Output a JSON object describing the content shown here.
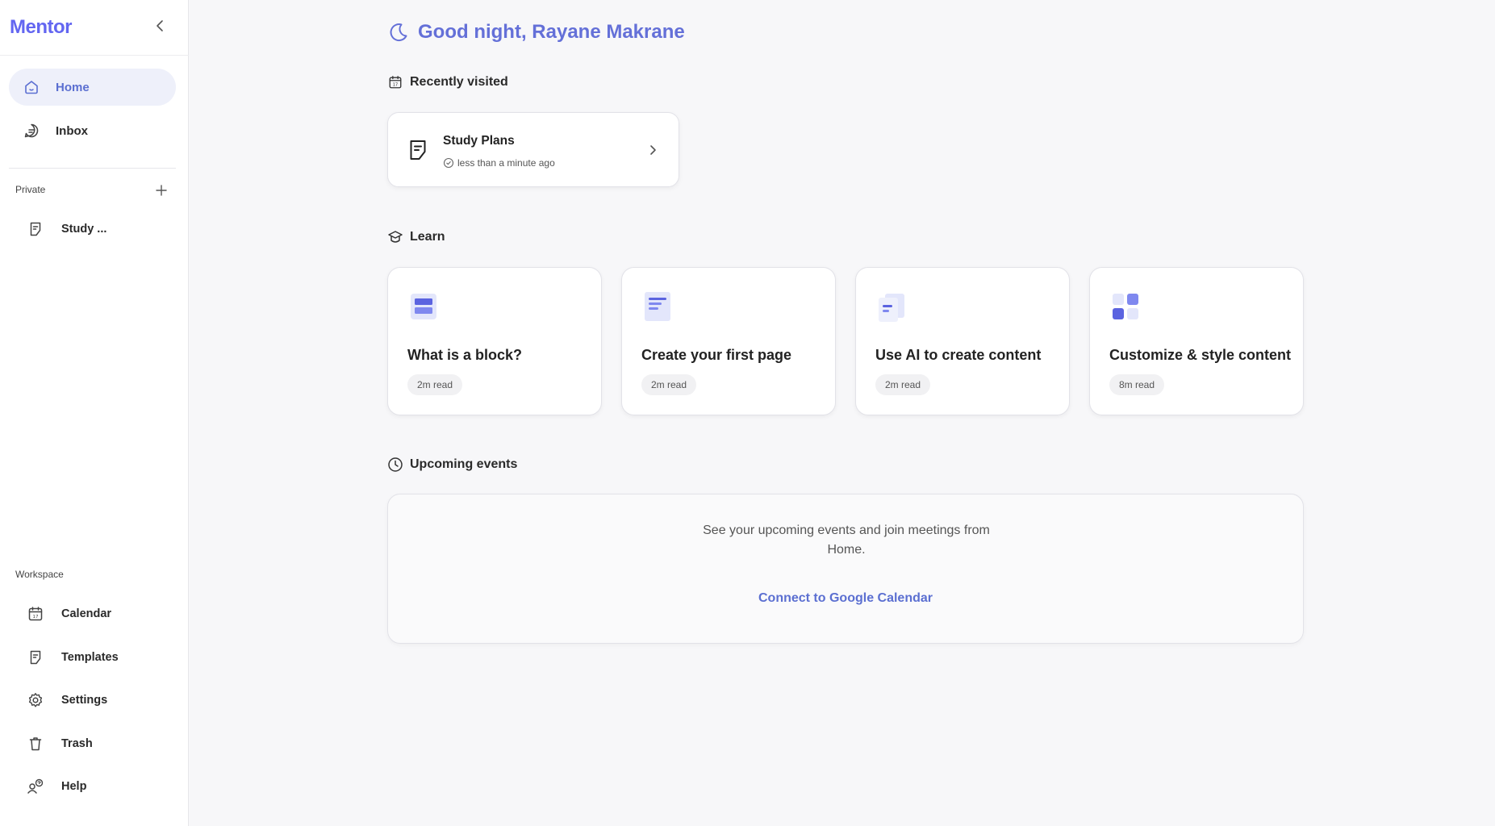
{
  "sidebar": {
    "brand": "Mentor",
    "nav": [
      {
        "label": "Home",
        "icon": "home-icon",
        "active": true
      },
      {
        "label": "Inbox",
        "icon": "inbox-icon",
        "active": false
      }
    ],
    "private_label": "Private",
    "private_items": [
      {
        "label": "Study ...",
        "icon": "document-icon"
      }
    ],
    "workspace_label": "Workspace",
    "workspace_items": [
      {
        "label": "Calendar",
        "icon": "calendar-icon"
      },
      {
        "label": "Templates",
        "icon": "template-icon"
      },
      {
        "label": "Settings",
        "icon": "gear-icon"
      },
      {
        "label": "Trash",
        "icon": "trash-icon"
      },
      {
        "label": "Help",
        "icon": "help-icon"
      }
    ]
  },
  "main": {
    "greeting": "Good night, Rayane Makrane",
    "recently_visited": {
      "heading": "Recently visited",
      "items": [
        {
          "title": "Study Plans",
          "time": "less than a minute ago"
        }
      ]
    },
    "learn": {
      "heading": "Learn",
      "cards": [
        {
          "title": "What is a block?",
          "read": "2m read"
        },
        {
          "title": "Create your first page",
          "read": "2m read"
        },
        {
          "title": "Use AI to create content",
          "read": "2m read"
        },
        {
          "title": "Customize & style content",
          "read": "8m read"
        }
      ]
    },
    "events": {
      "heading": "Upcoming events",
      "description": "See your upcoming events and join meetings from Home.",
      "connect_label": "Connect to Google Calendar"
    }
  },
  "colors": {
    "accent": "#6366f1",
    "link": "#5b6fd1",
    "active_bg": "#eef0fa"
  }
}
